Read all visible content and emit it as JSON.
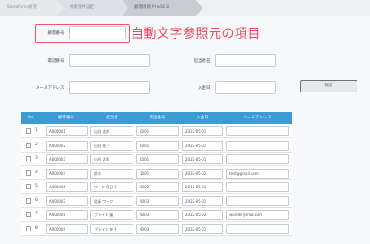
{
  "breadcrumb": [
    "SalesForce研究",
    "検索条件設定",
    "顧客情報(PHASE1)"
  ],
  "annotation": "自動文字参照元の項目",
  "form": {
    "customer_no_label": "顧客番号:",
    "customer_no_value": "",
    "phone_label": "電話番号:",
    "phone_value": "",
    "email_label": "メールアドレス:",
    "email_value": "",
    "name_label": "担当者名:",
    "name_value": "",
    "date_label": "入金日:",
    "date_value": "",
    "search_button": "検索"
  },
  "table": {
    "columns": [
      "No.",
      "顧客番号",
      "担当者",
      "電話番号",
      "入金日",
      "メールアドレス"
    ],
    "rows": [
      {
        "no": "1",
        "id": "A000001",
        "name": "山田 太郎",
        "tel": "0001",
        "date": "2022-05-01",
        "email": ""
      },
      {
        "no": "2",
        "id": "A000002",
        "name": "山田 花子",
        "tel": "0001",
        "date": "2022-05-01",
        "email": ""
      },
      {
        "no": "3",
        "id": "A000003",
        "name": "山田 太郎",
        "tel": "0001",
        "date": "2022-05-01",
        "email": ""
      },
      {
        "no": "4",
        "id": "A000004",
        "name": "鈴木",
        "tel": "1001",
        "date": "2022-05-02",
        "email": "test@gmail.com"
      },
      {
        "no": "5",
        "id": "A000005",
        "name": "ワーク 明日子",
        "tel": "9002",
        "date": "2012-05-01",
        "email": ""
      },
      {
        "no": "6",
        "id": "A000007",
        "name": "佐藤 ワーク",
        "tel": "9003",
        "date": "2022-05-01",
        "email": ""
      },
      {
        "no": "7",
        "id": "A000008",
        "name": "ブライト 蓮",
        "tel": "9003",
        "date": "2022-05-02",
        "email": "wonder@mail.com"
      },
      {
        "no": "8",
        "id": "A000009",
        "name": "ブライト 花子",
        "tel": "9003",
        "date": "2022-05-01",
        "email": ""
      }
    ]
  },
  "colors": {
    "header": "#3c9bd3",
    "highlight": "#f0546a",
    "annotation": "#ef4b5e"
  }
}
